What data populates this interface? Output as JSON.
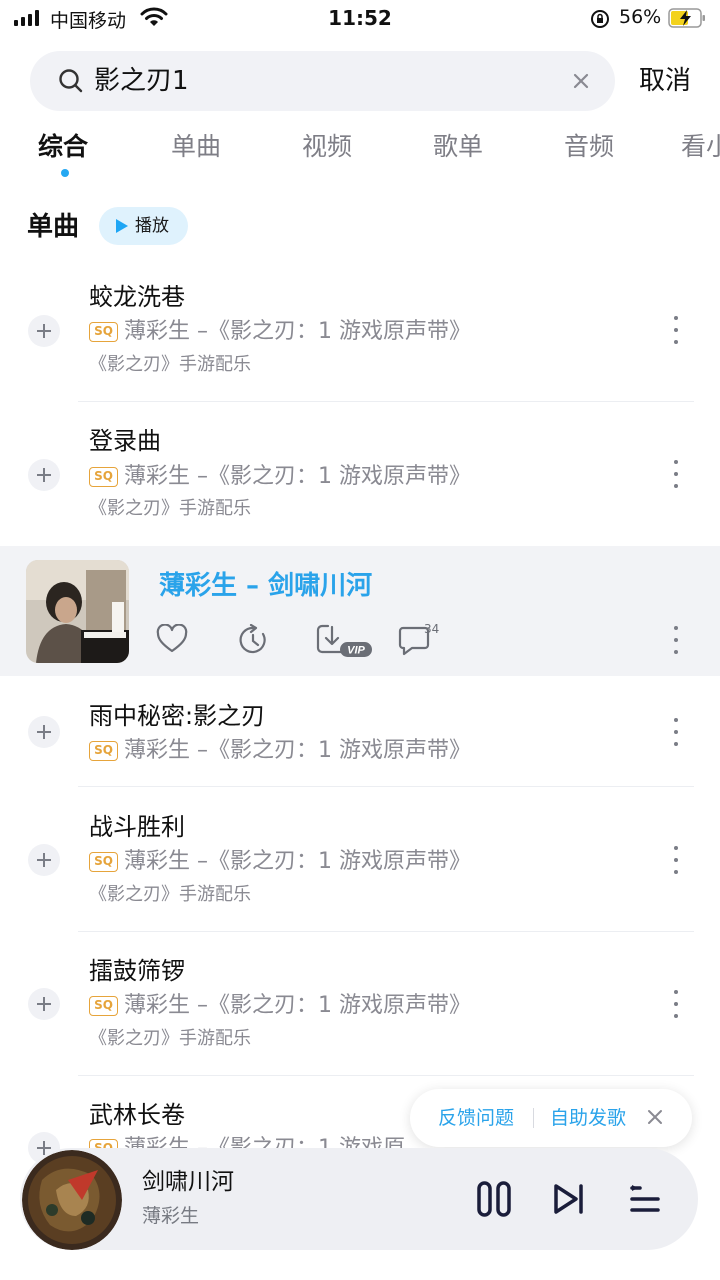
{
  "status_bar": {
    "carrier": "中国移动",
    "time": "11:52",
    "battery": "56%"
  },
  "search": {
    "query": "影之刃1",
    "cancel_label": "取消"
  },
  "tabs": [
    {
      "label": "综合",
      "active": true
    },
    {
      "label": "单曲",
      "active": false
    },
    {
      "label": "视频",
      "active": false
    },
    {
      "label": "歌单",
      "active": false
    },
    {
      "label": "音频",
      "active": false
    },
    {
      "label": "看小",
      "active": false
    }
  ],
  "section": {
    "title": "单曲",
    "play_label": "播放"
  },
  "songs": [
    {
      "title": "蛟龙洗巷",
      "badge": "SQ",
      "meta": "薄彩生 –《影之刃：1 游戏原声带》",
      "sub": "《影之刃》手游配乐"
    },
    {
      "title": "登录曲",
      "badge": "SQ",
      "meta": "薄彩生 –《影之刃：1 游戏原声带》",
      "sub": "《影之刃》手游配乐"
    },
    {
      "title": "雨中秘密:影之刃",
      "badge": "SQ",
      "meta": "薄彩生 –《影之刃：1 游戏原声带》",
      "sub": ""
    },
    {
      "title": "战斗胜利",
      "badge": "SQ",
      "meta": "薄彩生 –《影之刃：1 游戏原声带》",
      "sub": "《影之刃》手游配乐"
    },
    {
      "title": "擂鼓筛锣",
      "badge": "SQ",
      "meta": "薄彩生 –《影之刃：1 游戏原声带》",
      "sub": "《影之刃》手游配乐"
    },
    {
      "title": "武林长卷",
      "badge": "SQ",
      "meta": "薄彩生 –《影之刃：1 游戏原",
      "sub": ""
    }
  ],
  "expanded_song": {
    "title": "薄彩生 – 剑啸川河",
    "comment_count": "34",
    "download_badge": "VIP"
  },
  "feedback": {
    "report_label": "反馈问题",
    "upload_label": "自助发歌"
  },
  "player": {
    "title": "剑啸川河",
    "artist": "薄彩生"
  },
  "colors": {
    "accent": "#2aa3ea",
    "sq_badge": "#e6a43b",
    "background": "#ffffff",
    "row_highlight": "#f2f3f6"
  }
}
